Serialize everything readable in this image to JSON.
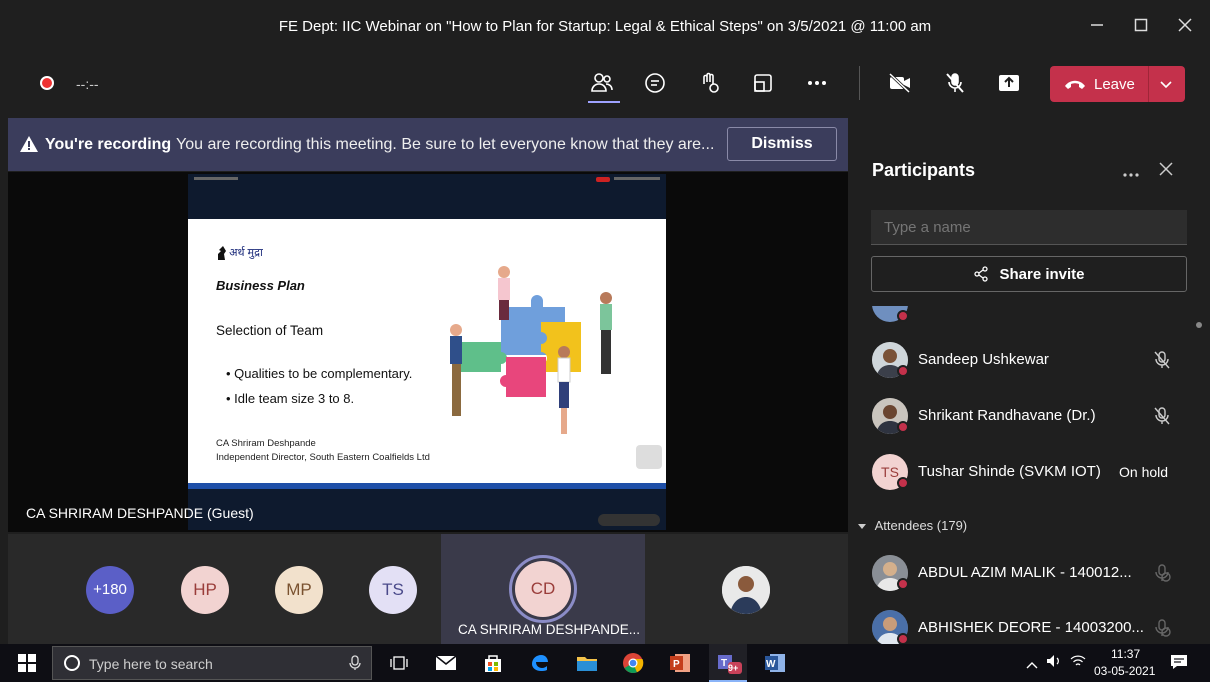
{
  "window": {
    "title": "FE Dept: IIC Webinar on \"How to Plan for Startup: Legal & Ethical Steps\" on 3/5/2021 @ 11:00 am"
  },
  "toolbar": {
    "recording_time": "--:--",
    "leave_label": "Leave"
  },
  "banner": {
    "bold": "You're recording",
    "message": "You are recording this meeting. Be sure to let everyone know that they are...",
    "dismiss_label": "Dismiss"
  },
  "slide": {
    "logo_text": "अर्थ मुद्रा",
    "title": "Business Plan",
    "subtitle": "Selection of Team",
    "bullets": [
      "• Qualities to be complementary.",
      "• Idle team size 3 to 8."
    ],
    "caption_line1": "CA Shriram Deshpande",
    "caption_line2": "Independent Director, South Eastern Coalfields Ltd"
  },
  "stage": {
    "speaker_label": "CA SHRIRAM DESHPANDE (Guest)"
  },
  "strip": {
    "overflow": "+180",
    "avatars": [
      "HP",
      "MP",
      "TS"
    ],
    "active_initials": "CD",
    "active_name": "CA SHRIRAM DESHPANDE..."
  },
  "participants": {
    "title": "Participants",
    "search_placeholder": "Type a name",
    "share_label": "Share invite",
    "people": [
      {
        "name": "Sandeep Ushkewar"
      },
      {
        "name": "Shrikant Randhavane (Dr.)"
      },
      {
        "name": "Tushar Shinde (SVKM IOT)",
        "initials": "TS",
        "status": "On hold"
      }
    ],
    "attendees_header": "Attendees (179)",
    "attendees": [
      {
        "name": "ABDUL AZIM MALIK - 140012..."
      },
      {
        "name": "ABHISHEK DEORE - 14003200..."
      }
    ]
  },
  "taskbar": {
    "search_placeholder": "Type here to search",
    "time": "11:37",
    "date": "03-05-2021",
    "teams_badge": "9+"
  },
  "colors": {
    "leave": "#c4314b",
    "banner": "#3b3d5c",
    "accent_ring": "#8b8cc7"
  }
}
